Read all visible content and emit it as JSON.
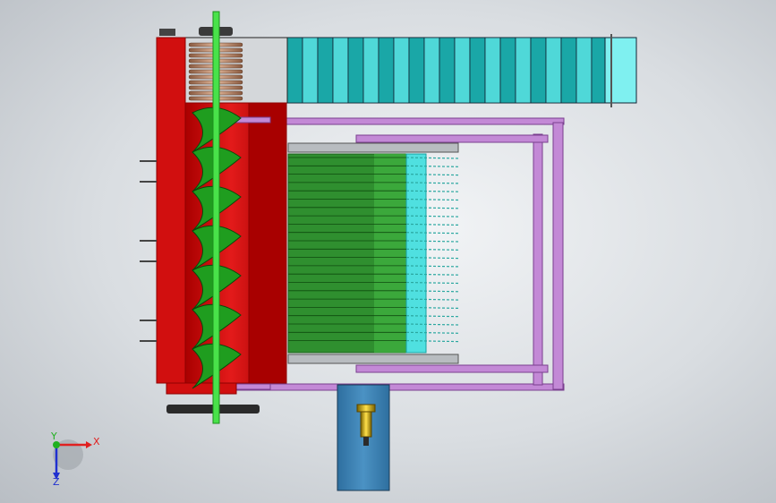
{
  "colors": {
    "frame": "#c389d6",
    "frame_dark": "#7a3f8f",
    "housing": "#d10f0f",
    "housing_dark": "#8e0000",
    "auger": "#1f9d1f",
    "shaft": "#49e24a",
    "conveyor": "#4fd8d8",
    "conveyor_dark": "#1aa7a7",
    "teeth": "#2f8f2f",
    "teeth_tip": "#4fe0e0",
    "motor_box": "#3f86b8",
    "bolt": "#d9b400"
  },
  "triad": {
    "x_label": "X",
    "y_label": "Y",
    "z_label": "Z",
    "x_color": "#e02020",
    "y_color": "#20b020",
    "z_color": "#2030d0"
  }
}
